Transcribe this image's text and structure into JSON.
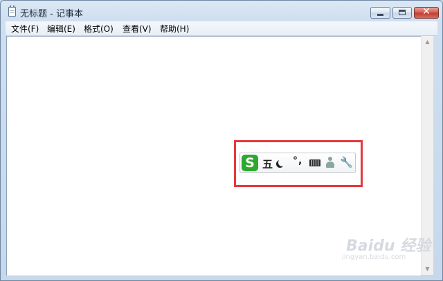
{
  "window": {
    "title": "无标题 - 记事本",
    "controls": {
      "minimize": "minimize",
      "maximize": "maximize",
      "close": "✕"
    }
  },
  "menubar": {
    "items": [
      {
        "label": "文件(F)"
      },
      {
        "label": "编辑(E)"
      },
      {
        "label": "格式(O)"
      },
      {
        "label": "查看(V)"
      },
      {
        "label": "帮助(H)"
      }
    ]
  },
  "editor": {
    "content": ""
  },
  "ime_toolbar": {
    "logo": "S",
    "mode_label": "五",
    "punctuation": "°,",
    "icons": [
      "sogou-logo-icon",
      "moon-icon",
      "punctuation-icon",
      "keyboard-icon",
      "user-icon",
      "wrench-icon"
    ],
    "highlight_color": "#e5383b",
    "logo_color": "#2fa82f"
  },
  "watermark": {
    "brand": "Baidu 经验",
    "url": "jingyan.baidu.com"
  }
}
